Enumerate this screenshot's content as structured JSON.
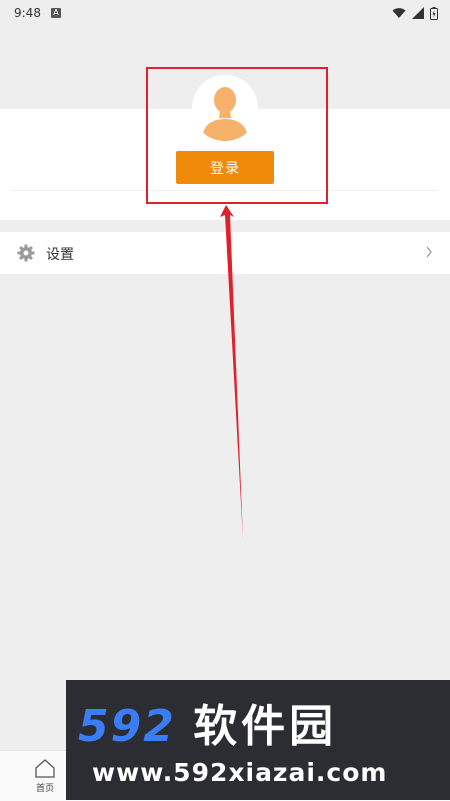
{
  "status_bar": {
    "time": "9:48",
    "notification_icon": "A"
  },
  "profile": {
    "login_label": "登录"
  },
  "settings": {
    "label": "设置"
  },
  "bottom_nav": {
    "home_label": "首页"
  },
  "watermark": {
    "brand_number": "592",
    "brand_text": "软件园",
    "url": "www.592xiazai.com"
  },
  "colors": {
    "accent": "#f08a0a",
    "highlight": "#e0202a",
    "avatar": "#f6b26b",
    "watermark_blue": "#3b7df5"
  }
}
